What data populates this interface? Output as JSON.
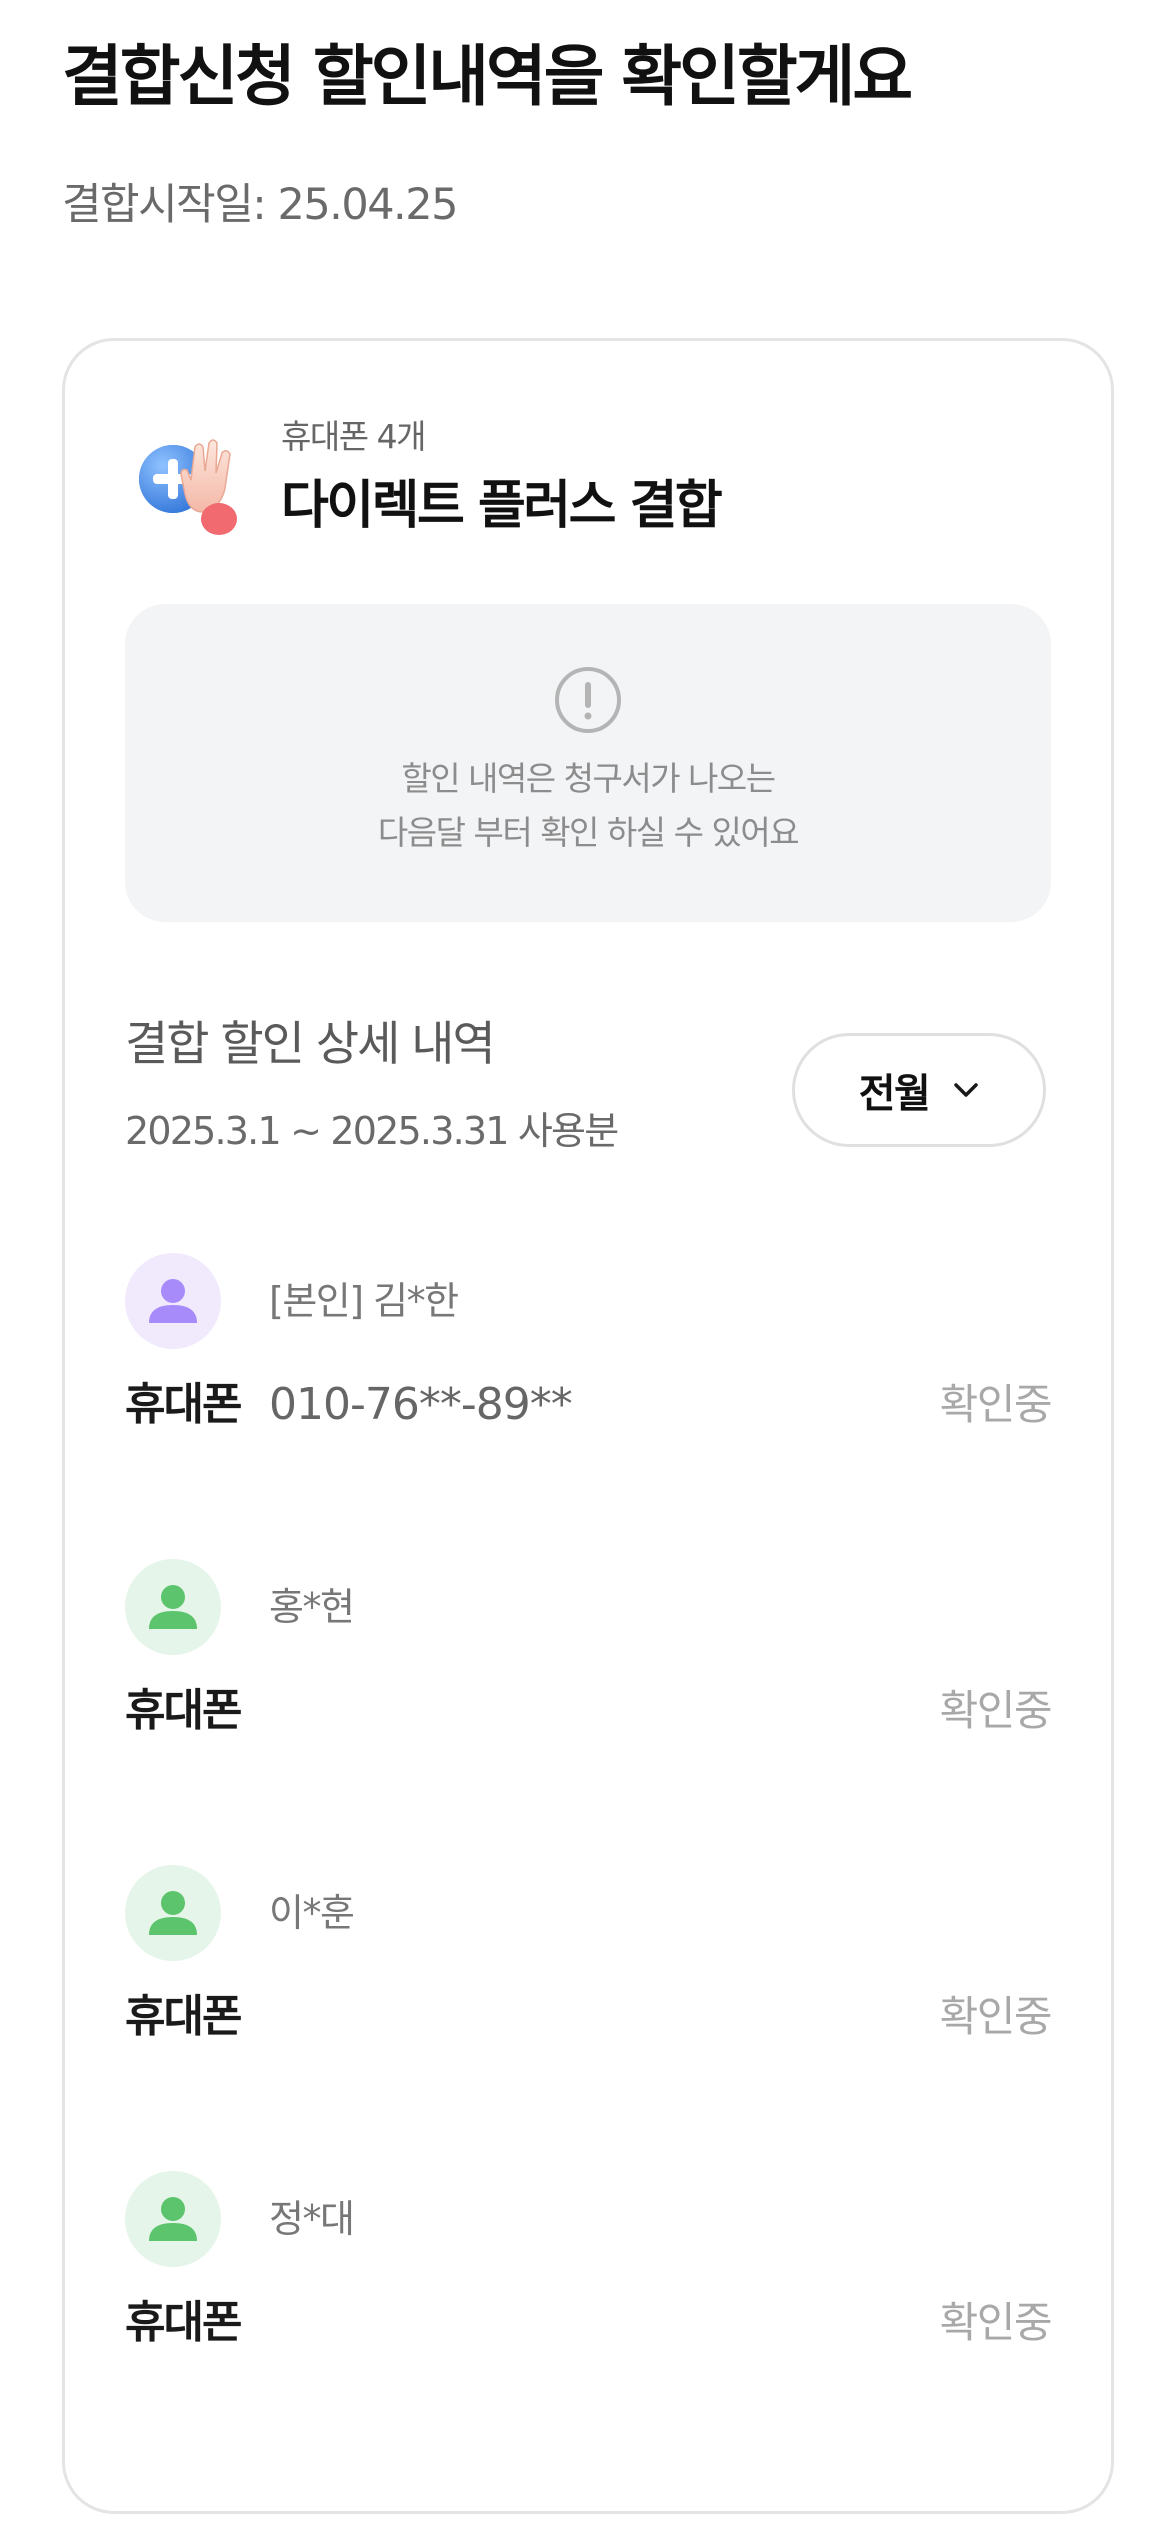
{
  "header": {
    "title": "결합신청 할인내역을 확인할게요",
    "start_date": "결합시작일: 25.04.25"
  },
  "plan": {
    "line_count": "휴대폰 4개",
    "name": "다이렉트 플러스 결합",
    "icon": "hand-plus-icon"
  },
  "notice": {
    "icon": "exclamation-circle-icon",
    "line1": "할인 내역은 청구서가 나오는",
    "line2": "다음달 부터 확인 하실 수 있어요"
  },
  "detail": {
    "title": "결합 할인 상세 내역",
    "period": "2025.3.1 ~ 2025.3.31 사용분",
    "period_button": "전월",
    "period_button_icon": "chevron-down-icon"
  },
  "members": [
    {
      "name": "[본인] 김*한",
      "device": "휴대폰",
      "number": "010-76**-89**",
      "status": "확인중",
      "avatar_color": "#a78bfa"
    },
    {
      "name": "홍*현",
      "device": "휴대폰",
      "number": "",
      "status": "확인중",
      "avatar_color": "#5cc46c"
    },
    {
      "name": "이*훈",
      "device": "휴대폰",
      "number": "",
      "status": "확인중",
      "avatar_color": "#5cc46c"
    },
    {
      "name": "정*대",
      "device": "휴대폰",
      "number": "",
      "status": "확인중",
      "avatar_color": "#5cc46c"
    }
  ]
}
